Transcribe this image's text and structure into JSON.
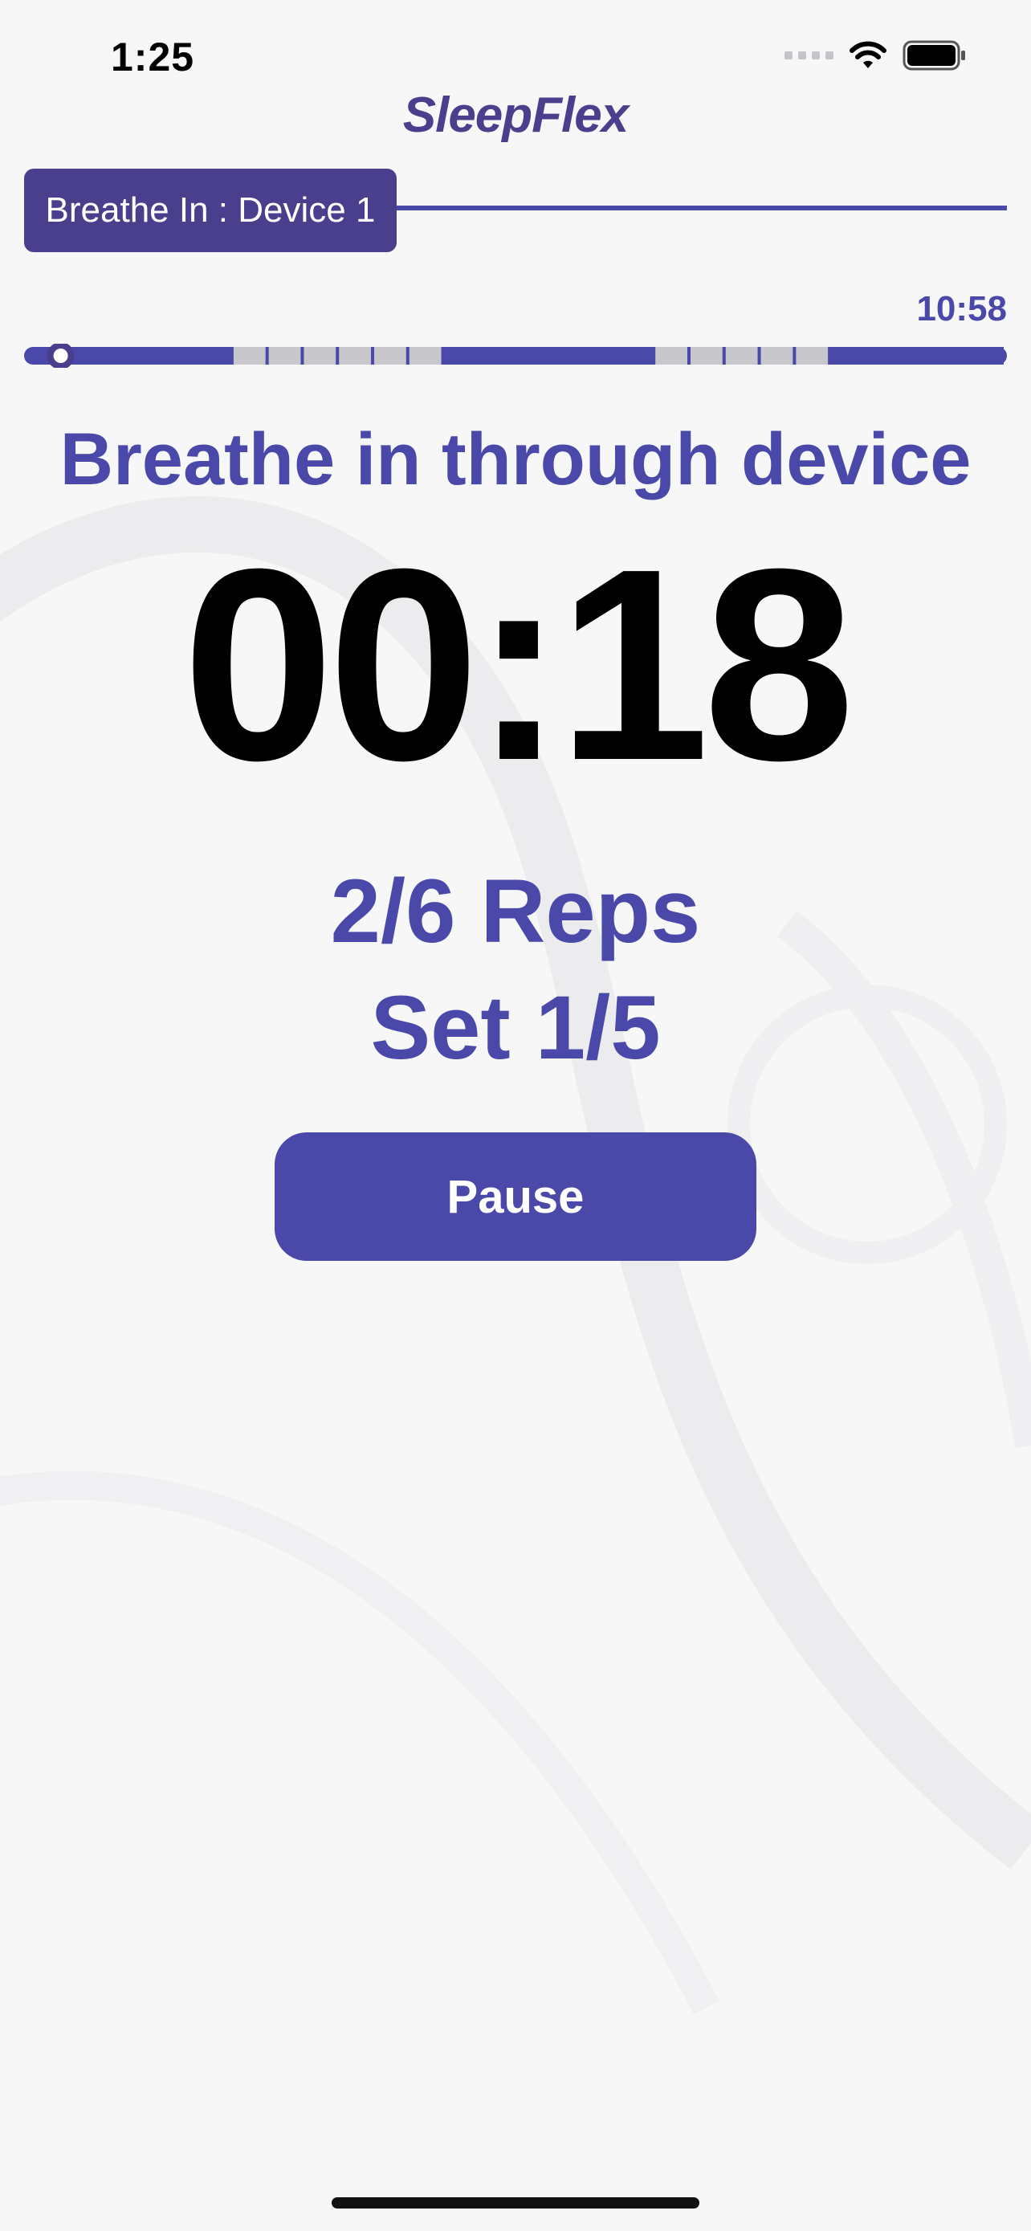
{
  "status_bar": {
    "time": "1:25"
  },
  "app": {
    "logo_text": "SleepFlex"
  },
  "exercise": {
    "step_label": "Breathe In : Device 1",
    "total_remaining": "10:58",
    "instruction": "Breathe in through device",
    "countdown": "00:18",
    "reps": "2/6 Reps",
    "set": "Set 1/5"
  },
  "progress": {
    "fraction": 0.016,
    "segments": [
      "active",
      "active",
      "active",
      "active",
      "active",
      "rest",
      "rest",
      "rest",
      "rest",
      "rest",
      "rest",
      "active",
      "active",
      "active",
      "active",
      "active",
      "active",
      "rest",
      "rest",
      "rest",
      "rest",
      "rest",
      "active",
      "active",
      "active",
      "active",
      "active"
    ]
  },
  "controls": {
    "pause_label": "Pause"
  },
  "colors": {
    "brand_dark": "#4a3f8c",
    "accent": "#4a48a8",
    "rest_segment": "#c8c8cc"
  }
}
